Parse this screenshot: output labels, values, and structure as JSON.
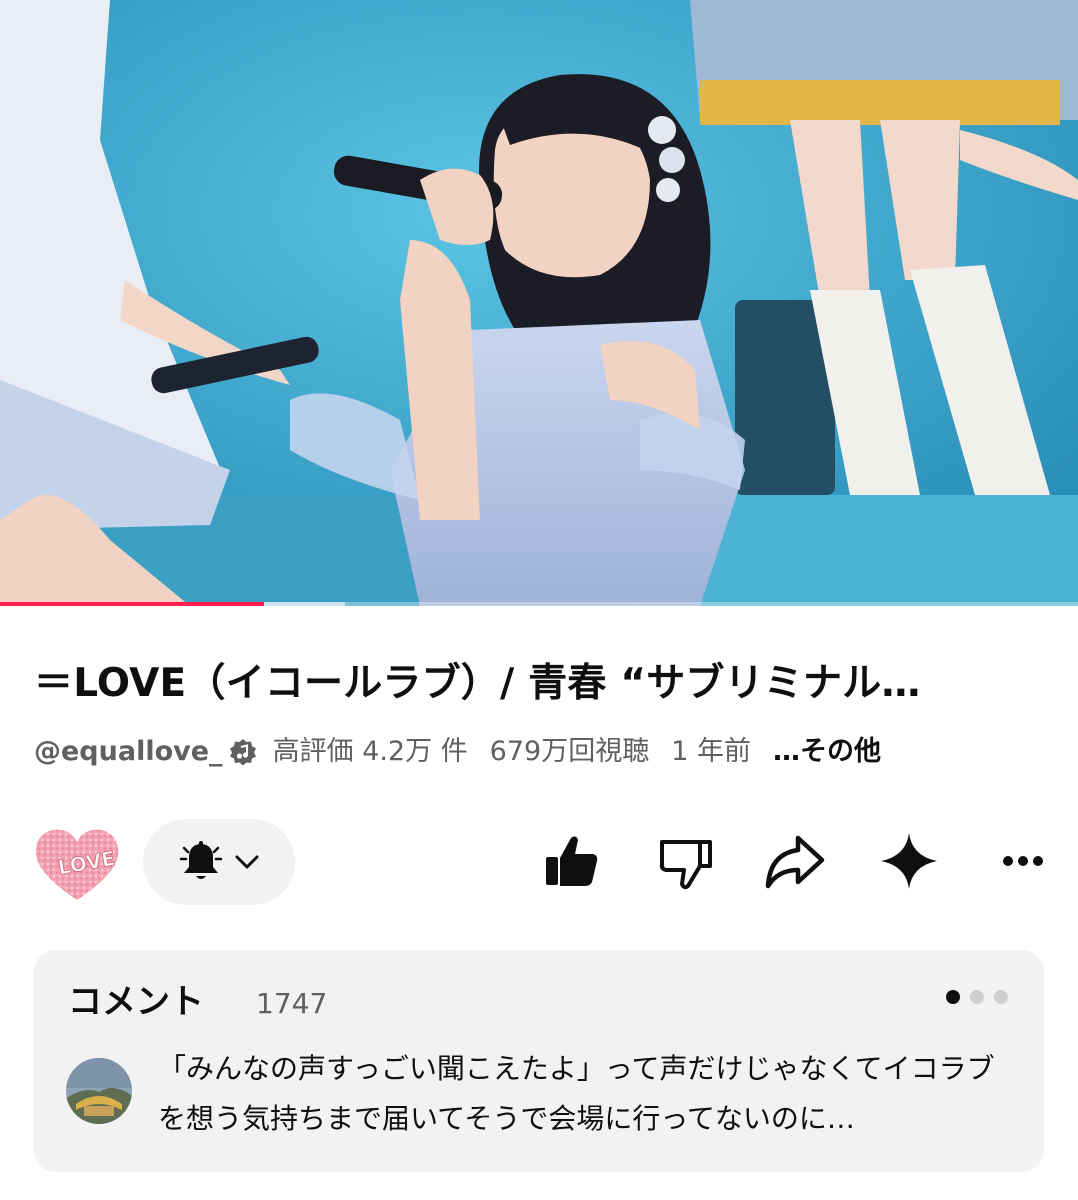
{
  "video": {
    "progress": 0.245,
    "buffered": 0.32,
    "colors": {
      "stage": "#35a4c9",
      "progress": "#ff1f4a"
    }
  },
  "video_info": {
    "title": "＝LOVE（イコールラブ）/ 青春 “サブリミナル…",
    "channel": "@equallove_",
    "likes": "高評価 4.2万 件",
    "views": "679万回視聴",
    "age": "1 年前",
    "more": "…その他"
  },
  "actions": {
    "channel_avatar_icon": "heart-love-icon",
    "subscribe_icons": [
      "bell-icon",
      "chevron-down-icon"
    ],
    "buttons": [
      "like-icon",
      "dislike-icon",
      "share-icon",
      "sparkle-icon",
      "more-icon"
    ]
  },
  "comments": {
    "heading": "コメント",
    "count": "1747",
    "pager_dots": 3,
    "active_dot": 0,
    "top_comment": "「みんなの声すっごい聞こえたよ」って声だけじゃなくてイコラブを想う気持ちまで届いてそうで会場に行ってないのに…"
  }
}
